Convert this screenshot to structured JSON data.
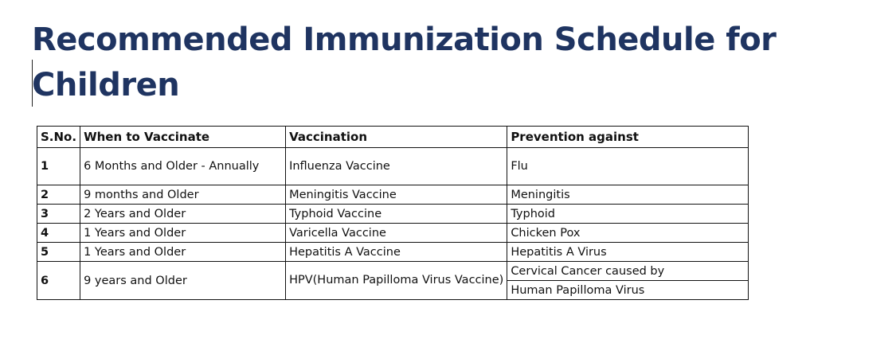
{
  "title": "Recommended Immunization Schedule for Children",
  "table": {
    "headers": {
      "sno": "S.No.",
      "when": "When to Vaccinate",
      "vaccination": "Vaccination",
      "prevention": "Prevention against"
    },
    "rows": [
      {
        "sno": "1",
        "when": "6 Months and Older - Annually",
        "vaccination": "Influenza Vaccine",
        "prevention": "Flu"
      },
      {
        "sno": "2",
        "when": "9 months and Older",
        "vaccination": "Meningitis Vaccine",
        "prevention": "Meningitis"
      },
      {
        "sno": "3",
        "when": "2 Years and Older",
        "vaccination": "Typhoid Vaccine",
        "prevention": "Typhoid"
      },
      {
        "sno": "4",
        "when": "1 Years and Older",
        "vaccination": "Varicella Vaccine",
        "prevention": "Chicken Pox"
      },
      {
        "sno": "5",
        "when": "1 Years and Older",
        "vaccination": "Hepatitis A Vaccine",
        "prevention": "Hepatitis A Virus"
      },
      {
        "sno": "6",
        "when": "9 years and Older",
        "vaccination": "HPV(Human Papilloma Virus Vaccine)",
        "prevention_line1": "Cervical Cancer caused by",
        "prevention_line2": "Human Papilloma Virus"
      }
    ]
  }
}
